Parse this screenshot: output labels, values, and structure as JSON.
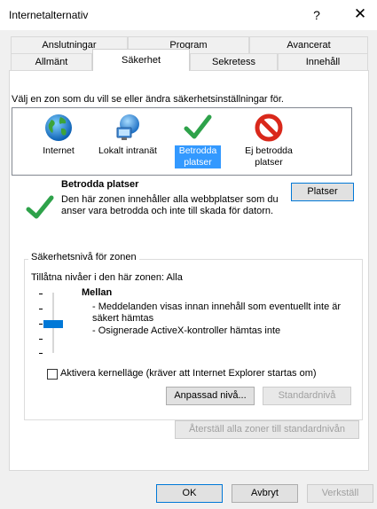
{
  "window": {
    "title": "Internetalternativ",
    "help": "?",
    "close": "✕"
  },
  "tabs": {
    "row1": [
      "Anslutningar",
      "Program",
      "Avancerat"
    ],
    "row2": [
      "Allmänt",
      "Säkerhet",
      "Sekretess",
      "Innehåll"
    ],
    "active": "Säkerhet"
  },
  "security": {
    "intro": "Välj en zon som du vill se eller ändra säkerhetsinställningar för.",
    "zones": [
      {
        "label": "Internet",
        "icon": "globe-icon"
      },
      {
        "label": "Lokalt intranät",
        "icon": "intranet-icon"
      },
      {
        "label": "Betrodda platser",
        "icon": "checkmark-icon",
        "selected": true
      },
      {
        "label": "Ej betrodda platser",
        "icon": "prohibited-icon"
      }
    ],
    "selected_zone": {
      "title": "Betrodda platser",
      "description": "Den här zonen innehåller alla webbplatser som du anser vara betrodda och inte till skada för datorn.",
      "sites_button": "Platser"
    },
    "level_group": {
      "legend": "Säkerhetsnivå för zonen",
      "allowed": "Tillåtna nivåer i den här zonen: Alla",
      "level_name": "Mellan",
      "level_desc": [
        "- Meddelanden visas innan innehåll som eventuellt inte är säkert hämtas",
        "- Osignerade ActiveX-kontroller hämtas inte"
      ],
      "kernel_checkbox": "Aktivera kernelläge (kräver att Internet Explorer startas om)",
      "kernel_checked": false,
      "custom_button": "Anpassad nivå...",
      "default_button": "Standardnivå"
    },
    "reset_all_button": "Återställ alla zoner till standardnivån"
  },
  "footer": {
    "ok": "OK",
    "cancel": "Avbryt",
    "apply": "Verkställ"
  },
  "colors": {
    "selection": "#3399ff",
    "slider": "#0078d7",
    "check_green": "#2ea24a",
    "prohibit_red": "#d9281b"
  }
}
